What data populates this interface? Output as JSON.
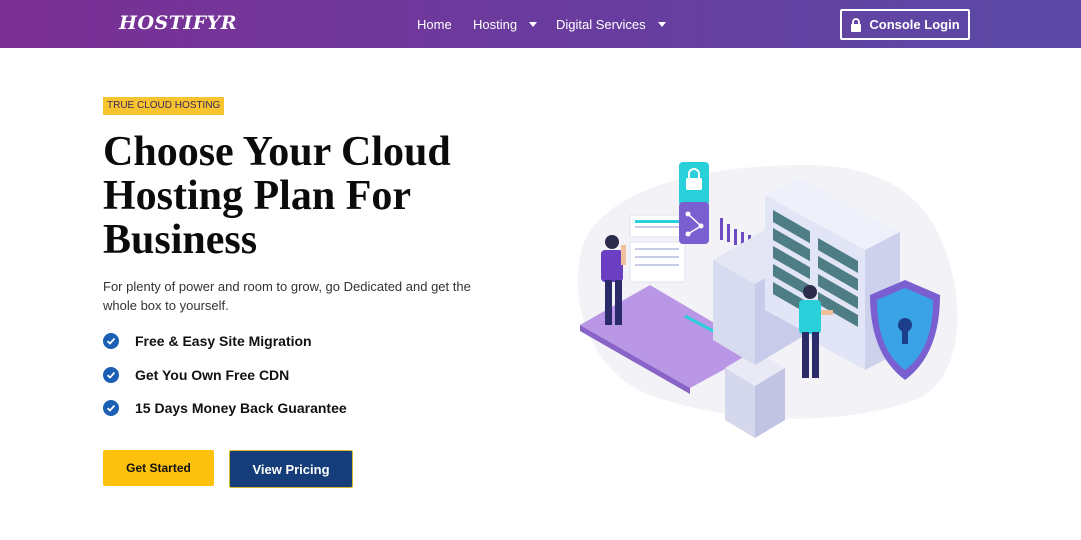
{
  "nav": {
    "logo": "HOSTIFYR",
    "links": [
      {
        "label": "Home"
      },
      {
        "label": "Hosting"
      },
      {
        "label": "Digital Services"
      }
    ],
    "console_label": "Console Login"
  },
  "hero": {
    "badge": "TRUE CLOUD HOSTING",
    "headline": "Choose Your Cloud Hosting Plan For Business",
    "subtext": "For plenty of power and room to grow, go Dedicated and get the whole box to yourself.",
    "features": [
      {
        "label": "Free & Easy Site Migration"
      },
      {
        "label": "Get You Own Free CDN"
      },
      {
        "label": "15 Days Money Back Guarantee"
      }
    ],
    "cta_primary": "Get Started",
    "cta_secondary": "View Pricing"
  },
  "colors": {
    "nav_gradient_start": "#7b2f94",
    "nav_gradient_end": "#5a4aa6",
    "accent_yellow": "#fcc10c",
    "dark_blue": "#143d7a",
    "check_blue": "#1a5fb4"
  }
}
